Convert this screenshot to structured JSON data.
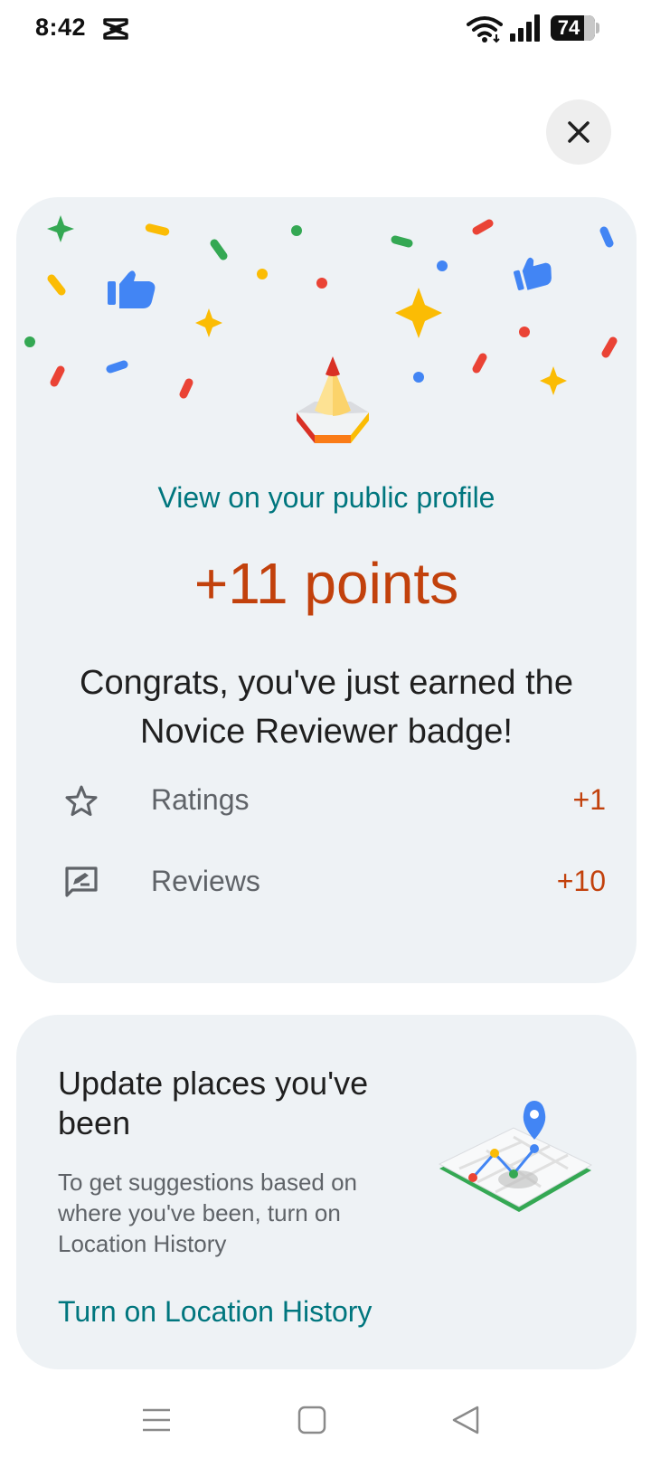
{
  "status_bar": {
    "time": "8:42",
    "battery": "74",
    "icons": [
      "capcut-icon",
      "wifi-icon",
      "signal-icon",
      "battery-icon"
    ]
  },
  "close_button": {
    "icon": "close-icon"
  },
  "points_card": {
    "profile_link": "View on your public profile",
    "points_total": "+11 points",
    "congrats": "Congrats, you've just earned the Novice Reviewer badge!",
    "stats": [
      {
        "icon": "star-outline-icon",
        "label": "Ratings",
        "value": "+1"
      },
      {
        "icon": "rate-review-icon",
        "label": "Reviews",
        "value": "+10"
      }
    ]
  },
  "location_card": {
    "title": "Update places you've been",
    "body": "To get suggestions based on where you've been, turn on Location History",
    "action": "Turn on Location History"
  },
  "nav_bar": {
    "icons": [
      "recents-icon",
      "home-icon",
      "back-icon"
    ]
  },
  "colors": {
    "accent_link": "#00767e",
    "points": "#c2410c",
    "card_bg": "#eef2f5",
    "google_blue": "#4285f4",
    "google_red": "#ea4335",
    "google_yellow": "#fbbc04",
    "google_green": "#34a853"
  }
}
